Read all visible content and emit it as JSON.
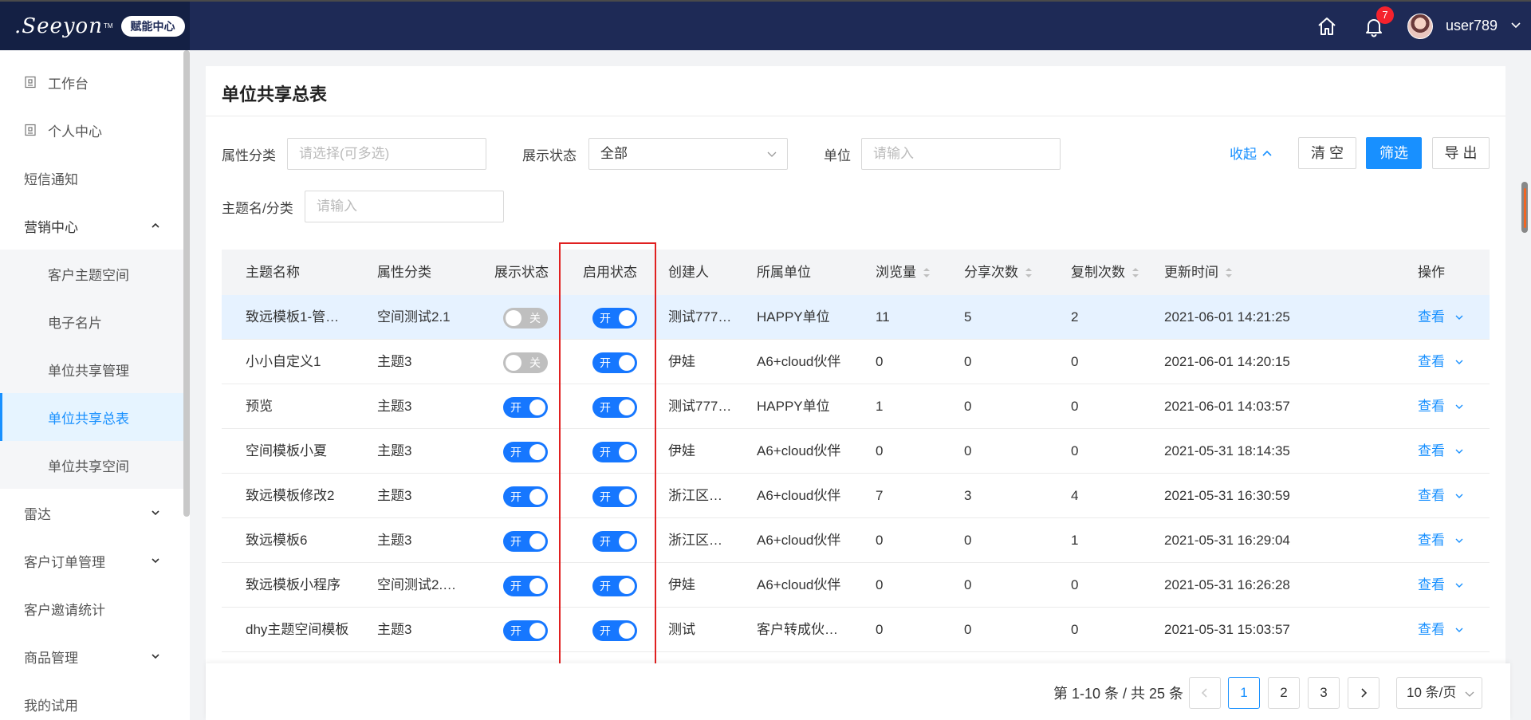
{
  "header": {
    "logo_text": ".Seeyon",
    "logo_tm": "TM",
    "logo_badge": "赋能中心",
    "notification_count": "7",
    "username": "user789"
  },
  "sidebar": {
    "items": [
      {
        "label": "工作台",
        "icon": "workbench-icon"
      },
      {
        "label": "个人中心",
        "icon": "personal-center-icon"
      },
      {
        "label": "短信通知"
      },
      {
        "label": "营销中心",
        "expanded": true
      },
      {
        "label": "客户主题空间"
      },
      {
        "label": "电子名片"
      },
      {
        "label": "单位共享管理"
      },
      {
        "label": "单位共享总表",
        "active": true
      },
      {
        "label": "单位共享空间"
      },
      {
        "label": "雷达",
        "expanded": false
      },
      {
        "label": "客户订单管理",
        "expanded": false
      },
      {
        "label": "客户邀请统计"
      },
      {
        "label": "商品管理",
        "expanded": false
      },
      {
        "label": "我的试用"
      }
    ]
  },
  "page": {
    "title": "单位共享总表"
  },
  "filters": {
    "attr_label": "属性分类",
    "attr_placeholder": "请选择(可多选)",
    "display_label": "展示状态",
    "display_value": "全部",
    "unit_label": "单位",
    "unit_placeholder": "请输入",
    "topic_label": "主题名/分类",
    "topic_placeholder": "请输入",
    "collapse": "收起",
    "clear": "清 空",
    "filter": "筛选",
    "export": "导 出"
  },
  "table": {
    "columns": [
      "主题名称",
      "属性分类",
      "展示状态",
      "启用状态",
      "创建人",
      "所属单位",
      "浏览量",
      "分享次数",
      "复制次数",
      "更新时间",
      "操作"
    ],
    "switch_on_label": "开",
    "switch_off_label": "关",
    "view_label": "查看",
    "rows": [
      {
        "name": "致远模板1-管…",
        "category": "空间测试2.1",
        "display": false,
        "enabled": true,
        "creator": "测试777…",
        "unit": "HAPPY单位",
        "views": "11",
        "shares": "5",
        "copies": "2",
        "updated": "2021-06-01 14:21:25"
      },
      {
        "name": "小小自定义1",
        "category": "主题3",
        "display": false,
        "enabled": true,
        "creator": "伊娃",
        "unit": "A6+cloud伙伴",
        "views": "0",
        "shares": "0",
        "copies": "0",
        "updated": "2021-06-01 14:20:15"
      },
      {
        "name": "预览",
        "category": "主题3",
        "display": true,
        "enabled": true,
        "creator": "测试777…",
        "unit": "HAPPY单位",
        "views": "1",
        "shares": "0",
        "copies": "0",
        "updated": "2021-06-01 14:03:57"
      },
      {
        "name": "空间模板小夏",
        "category": "主题3",
        "display": true,
        "enabled": true,
        "creator": "伊娃",
        "unit": "A6+cloud伙伴",
        "views": "0",
        "shares": "0",
        "copies": "0",
        "updated": "2021-05-31 18:14:35"
      },
      {
        "name": "致远模板修改2",
        "category": "主题3",
        "display": true,
        "enabled": true,
        "creator": "浙江区…",
        "unit": "A6+cloud伙伴",
        "views": "7",
        "shares": "3",
        "copies": "4",
        "updated": "2021-05-31 16:30:59"
      },
      {
        "name": "致远模板6",
        "category": "主题3",
        "display": true,
        "enabled": true,
        "creator": "浙江区…",
        "unit": "A6+cloud伙伴",
        "views": "0",
        "shares": "0",
        "copies": "1",
        "updated": "2021-05-31 16:29:04"
      },
      {
        "name": "致远模板小程序",
        "category": "空间测试2.…",
        "display": true,
        "enabled": true,
        "creator": "伊娃",
        "unit": "A6+cloud伙伴",
        "views": "0",
        "shares": "0",
        "copies": "0",
        "updated": "2021-05-31 16:26:28"
      },
      {
        "name": "dhy主题空间模板",
        "category": "主题3",
        "display": true,
        "enabled": true,
        "creator": "测试",
        "unit": "客户转成伙…",
        "views": "0",
        "shares": "0",
        "copies": "0",
        "updated": "2021-05-31 15:03:57"
      }
    ]
  },
  "pagination": {
    "info": "第 1-10 条 / 共 25 条",
    "pages": [
      "1",
      "2",
      "3"
    ],
    "current": "1",
    "page_size": "10 条/页"
  },
  "colors": {
    "topbar": "#1e2a56",
    "accent": "#1890ff",
    "highlight_box": "#e02020"
  }
}
